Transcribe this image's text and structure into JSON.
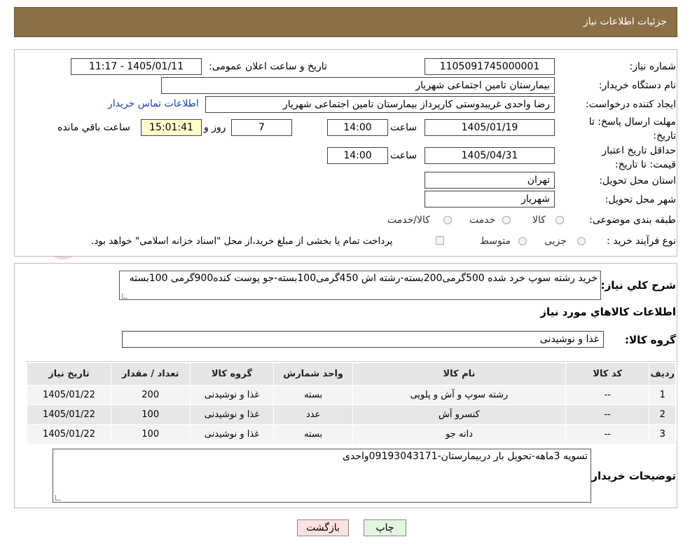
{
  "header": {
    "title": "جزئیات اطلاعات نیاز"
  },
  "form": {
    "need_number_label": "شماره نیاز:",
    "need_number": "1105091745000001",
    "announce_label": "تاریخ و ساعت اعلان عمومی:",
    "announce_value": "1405/01/11 - 11:17",
    "buyer_org_label": "نام دستگاه خریدار:",
    "buyer_org": "بیمارستان تامین اجتماعی شهریار",
    "creator_label": "ایجاد کننده درخواست:",
    "creator": "رضا واحدی غریبدوستی کارپرداز بیمارستان تامین اجتماعی شهریار",
    "contact_link": "اطلاعات تماس خریدار",
    "deadline_label": "مهلت ارسال پاسخ: تا تاریخ:",
    "deadline_date": "1405/01/19",
    "time_label": "ساعت",
    "deadline_time": "14:00",
    "days_value": "7",
    "days_label": "روز و",
    "remaining_time": "15:01:41",
    "remaining_label": "ساعت باقي مانده",
    "validity_label": "حداقل تاریخ اعتبار قیمت: تا تاریخ:",
    "validity_date": "1405/04/31",
    "validity_time": "14:00",
    "province_label": "استان محل تحویل:",
    "province": "تهران",
    "city_label": "شهر محل تحویل:",
    "city": "شهریار",
    "category_label": "طبقه بندی موضوعی:",
    "category_options": [
      "کالا",
      "خدمت",
      "کالا/خدمت"
    ],
    "process_label": "نوع فرآیند خرید :",
    "process_options": [
      "جزیی",
      "متوسط"
    ],
    "payment_note": "پرداخت تمام یا بخشی از مبلغ خرید،از محل \"اسناد خزانه اسلامی\" خواهد بود."
  },
  "summary": {
    "label": "شرح کلي نياز:",
    "text": "خرید رشته سوپ خرد شده 500گرمی200بسته-رشته اش 450گرمی100بسته-جو پوست کنده900گرمی 100بسته"
  },
  "goods": {
    "section_title": "اطلاعات كالاهاي مورد نياز",
    "group_label": "گروه كالا:",
    "group_value": "غذا و نوشیدنی",
    "columns": [
      "رديف",
      "كد كالا",
      "نام كالا",
      "واحد شمارش",
      "گروه كالا",
      "تعداد / مقدار",
      "تاريخ نياز"
    ],
    "rows": [
      [
        "1",
        "--",
        "رشته سوپ و آش و پلویی",
        "بسته",
        "غذا و نوشیدنی",
        "200",
        "1405/01/22"
      ],
      [
        "2",
        "--",
        "کنسرو آش",
        "عدد",
        "غذا و نوشیدنی",
        "100",
        "1405/01/22"
      ],
      [
        "3",
        "--",
        "دانه جو",
        "بسته",
        "غذا و نوشیدنی",
        "100",
        "1405/01/22"
      ]
    ]
  },
  "buyer_notes": {
    "label": "توضیحات خریدار:",
    "text": "تسویه 3ماهه-تحویل بار دربیمارستان-09193043171واحدی"
  },
  "buttons": {
    "print": "چاپ",
    "back": "بازگشت"
  },
  "watermark": {
    "text": "AriaTender.neT"
  },
  "colors": {
    "header_bg": "#8b6f47",
    "link": "#1a3fc7",
    "remaining_bg": "#ffffcc",
    "back_button_bg": "#fde2e2",
    "print_button_bg": "#e3f6e0"
  }
}
